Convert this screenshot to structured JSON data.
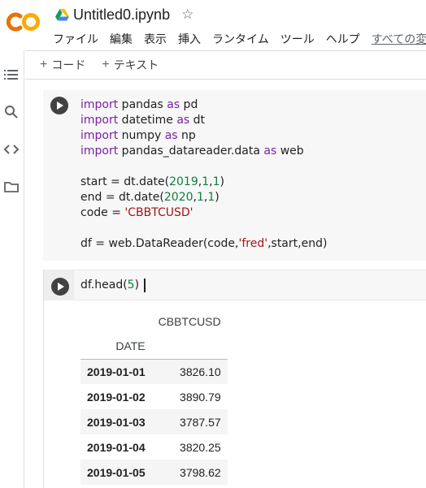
{
  "colors": {
    "accent_orange": "#F9AB00",
    "keyword": "#7b20a2",
    "number": "#0b7f3f",
    "string": "#a31515"
  },
  "header": {
    "notebook_title": "Untitled0.ipynb",
    "star_icon": "star-outline-icon",
    "menu": [
      "ファイル",
      "編集",
      "表示",
      "挿入",
      "ランタイム",
      "ツール",
      "ヘルプ",
      "すべての変"
    ]
  },
  "rail": {
    "icons": [
      "toc-icon",
      "search-icon",
      "code-snippets-icon",
      "folder-icon"
    ]
  },
  "toolbar": {
    "add_code": "コード",
    "add_text": "テキスト"
  },
  "cell1": {
    "lines": [
      [
        {
          "t": "import",
          "c": "kw"
        },
        {
          "t": " pandas "
        },
        {
          "t": "as",
          "c": "kw"
        },
        {
          "t": " pd"
        }
      ],
      [
        {
          "t": "import",
          "c": "kw"
        },
        {
          "t": " datetime "
        },
        {
          "t": "as",
          "c": "kw"
        },
        {
          "t": " dt"
        }
      ],
      [
        {
          "t": "import",
          "c": "kw"
        },
        {
          "t": " numpy "
        },
        {
          "t": "as",
          "c": "kw"
        },
        {
          "t": " np"
        }
      ],
      [
        {
          "t": "import",
          "c": "kw"
        },
        {
          "t": " pandas_datareader.data "
        },
        {
          "t": "as",
          "c": "kw"
        },
        {
          "t": " web"
        }
      ],
      [],
      [
        {
          "t": "start = dt.date("
        },
        {
          "t": "2019",
          "c": "num"
        },
        {
          "t": ","
        },
        {
          "t": "1",
          "c": "num"
        },
        {
          "t": ","
        },
        {
          "t": "1",
          "c": "num"
        },
        {
          "t": ")"
        }
      ],
      [
        {
          "t": "end = dt.date("
        },
        {
          "t": "2020",
          "c": "num"
        },
        {
          "t": ","
        },
        {
          "t": "1",
          "c": "num"
        },
        {
          "t": ","
        },
        {
          "t": "1",
          "c": "num"
        },
        {
          "t": ")"
        }
      ],
      [
        {
          "t": "code = "
        },
        {
          "t": "'CBBTCUSD'",
          "c": "str"
        }
      ],
      [],
      [
        {
          "t": "df = web.DataReader(code,"
        },
        {
          "t": "'fred'",
          "c": "str"
        },
        {
          "t": ",start,end)"
        }
      ]
    ]
  },
  "cell2": {
    "code_prefix": "df.head(",
    "code_num": "5",
    "code_suffix": ")",
    "output": {
      "column": "CBBTCUSD",
      "index_name": "DATE",
      "rows": [
        {
          "date": "2019-01-01",
          "value": "3826.10"
        },
        {
          "date": "2019-01-02",
          "value": "3890.79"
        },
        {
          "date": "2019-01-03",
          "value": "3787.57"
        },
        {
          "date": "2019-01-04",
          "value": "3820.25"
        },
        {
          "date": "2019-01-05",
          "value": "3798.62"
        }
      ]
    }
  }
}
